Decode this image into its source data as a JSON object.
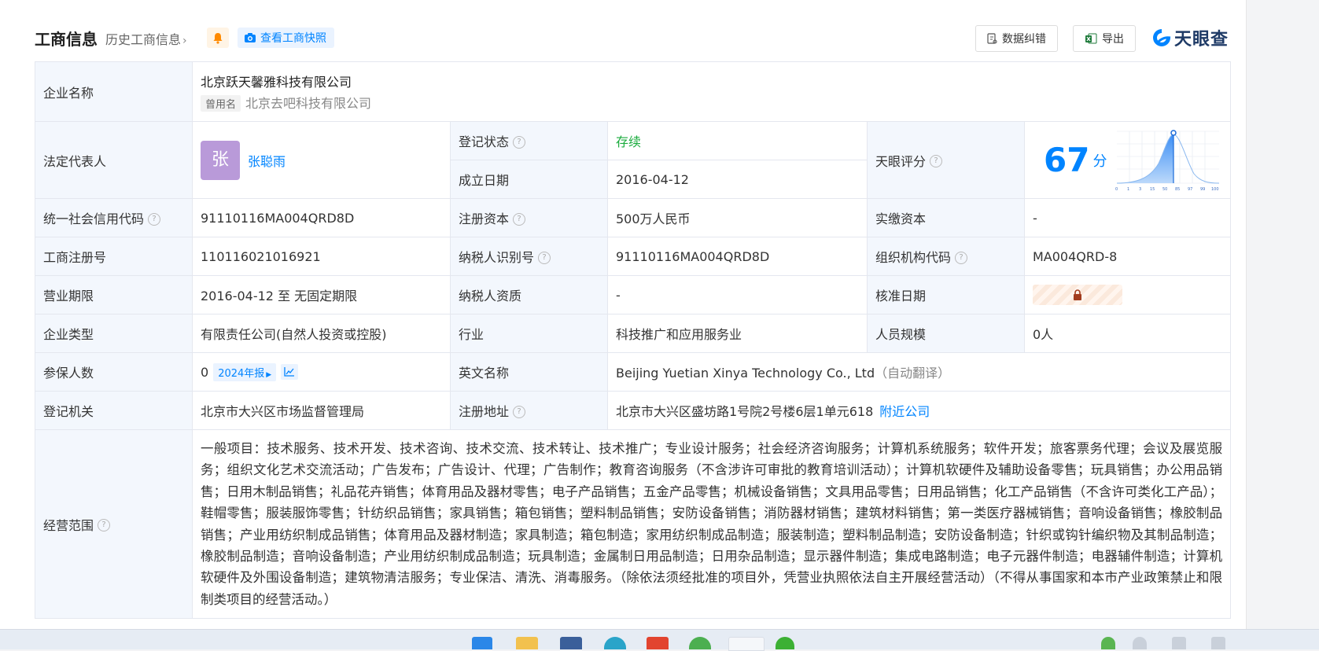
{
  "header": {
    "title": "工商信息",
    "history_link": "历史工商信息",
    "snapshot_label": "查看工商快照",
    "data_fix_label": "数据纠错",
    "export_label": "导出",
    "brand": "天眼查"
  },
  "rows": {
    "company_name": {
      "label": "企业名称",
      "value": "北京跃天馨雅科技有限公司",
      "used_tag": "曾用名",
      "used_name": "北京去吧科技有限公司"
    },
    "legal_rep": {
      "label": "法定代表人",
      "avatar_char": "张",
      "name": "张聪雨"
    },
    "reg_status": {
      "label": "登记状态",
      "value": "存续"
    },
    "found_date": {
      "label": "成立日期",
      "value": "2016-04-12"
    },
    "tianyan_score": {
      "label": "天眼评分",
      "score": "67",
      "unit": "分",
      "axis_ticks": [
        "0",
        "1",
        "3",
        "15",
        "50",
        "85",
        "97",
        "99",
        "100"
      ]
    },
    "credit_code": {
      "label": "统一社会信用代码",
      "value": "91110116MA004QRD8D"
    },
    "reg_capital": {
      "label": "注册资本",
      "value": "500万人民币"
    },
    "paid_capital": {
      "label": "实缴资本",
      "value": "-"
    },
    "reg_no": {
      "label": "工商注册号",
      "value": "110116021016921"
    },
    "taxpayer_id": {
      "label": "纳税人识别号",
      "value": "91110116MA004QRD8D"
    },
    "org_code": {
      "label": "组织机构代码",
      "value": "MA004QRD-8"
    },
    "biz_term": {
      "label": "营业期限",
      "value": "2016-04-12 至 无固定期限"
    },
    "taxpayer_qual": {
      "label": "纳税人资质",
      "value": "-"
    },
    "approve_date": {
      "label": "核准日期"
    },
    "company_type": {
      "label": "企业类型",
      "value": "有限责任公司(自然人投资或控股)"
    },
    "industry": {
      "label": "行业",
      "value": "科技推广和应用服务业"
    },
    "staff_size": {
      "label": "人员规模",
      "value": "0人"
    },
    "insured": {
      "label": "参保人数",
      "value": "0",
      "report_label": "2024年报"
    },
    "english_name": {
      "label": "英文名称",
      "value": "Beijing Yuetian Xinya Technology Co., Ltd",
      "auto_note": "（自动翻译）"
    },
    "reg_authority": {
      "label": "登记机关",
      "value": "北京市大兴区市场监督管理局"
    },
    "reg_address": {
      "label": "注册地址",
      "value": "北京市大兴区盛坊路1号院2号楼6层1单元618",
      "nearby_link": "附近公司"
    },
    "biz_scope": {
      "label": "经营范围",
      "value": "一般项目：技术服务、技术开发、技术咨询、技术交流、技术转让、技术推广；专业设计服务；社会经济咨询服务；计算机系统服务；软件开发；旅客票务代理；会议及展览服务；组织文化艺术交流活动；广告发布；广告设计、代理；广告制作；教育咨询服务（不含涉许可审批的教育培训活动）；计算机软硬件及辅助设备零售；玩具销售；办公用品销售；日用木制品销售；礼品花卉销售；体育用品及器材零售；电子产品销售；五金产品零售；机械设备销售；文具用品零售；日用品销售；化工产品销售（不含许可类化工产品）；鞋帽零售；服装服饰零售；针纺织品销售；家具销售；箱包销售；塑料制品销售；安防设备销售；消防器材销售；建筑材料销售；第一类医疗器械销售；音响设备销售；橡胶制品销售；产业用纺织制成品销售；体育用品及器材制造；家具制造；箱包制造；家用纺织制成品制造；服装制造；塑料制品制造；安防设备制造；针织或钩针编织物及其制品制造；橡胶制品制造；音响设备制造；产业用纺织制成品制造；玩具制造；金属制日用品制造；日用杂品制造；显示器件制造；集成电路制造；电子元器件制造；电器辅件制造；计算机软硬件及外围设备制造；建筑物清洁服务；专业保洁、清洗、消毒服务。（除依法须经批准的项目外，凭营业执照依法自主开展经营活动）（不得从事国家和本市产业政策禁止和限制类项目的经营活动。）"
    }
  },
  "colors": {
    "accent": "#0084ff",
    "status_green": "#1aab3d",
    "label_bg": "#f3f7fd"
  }
}
